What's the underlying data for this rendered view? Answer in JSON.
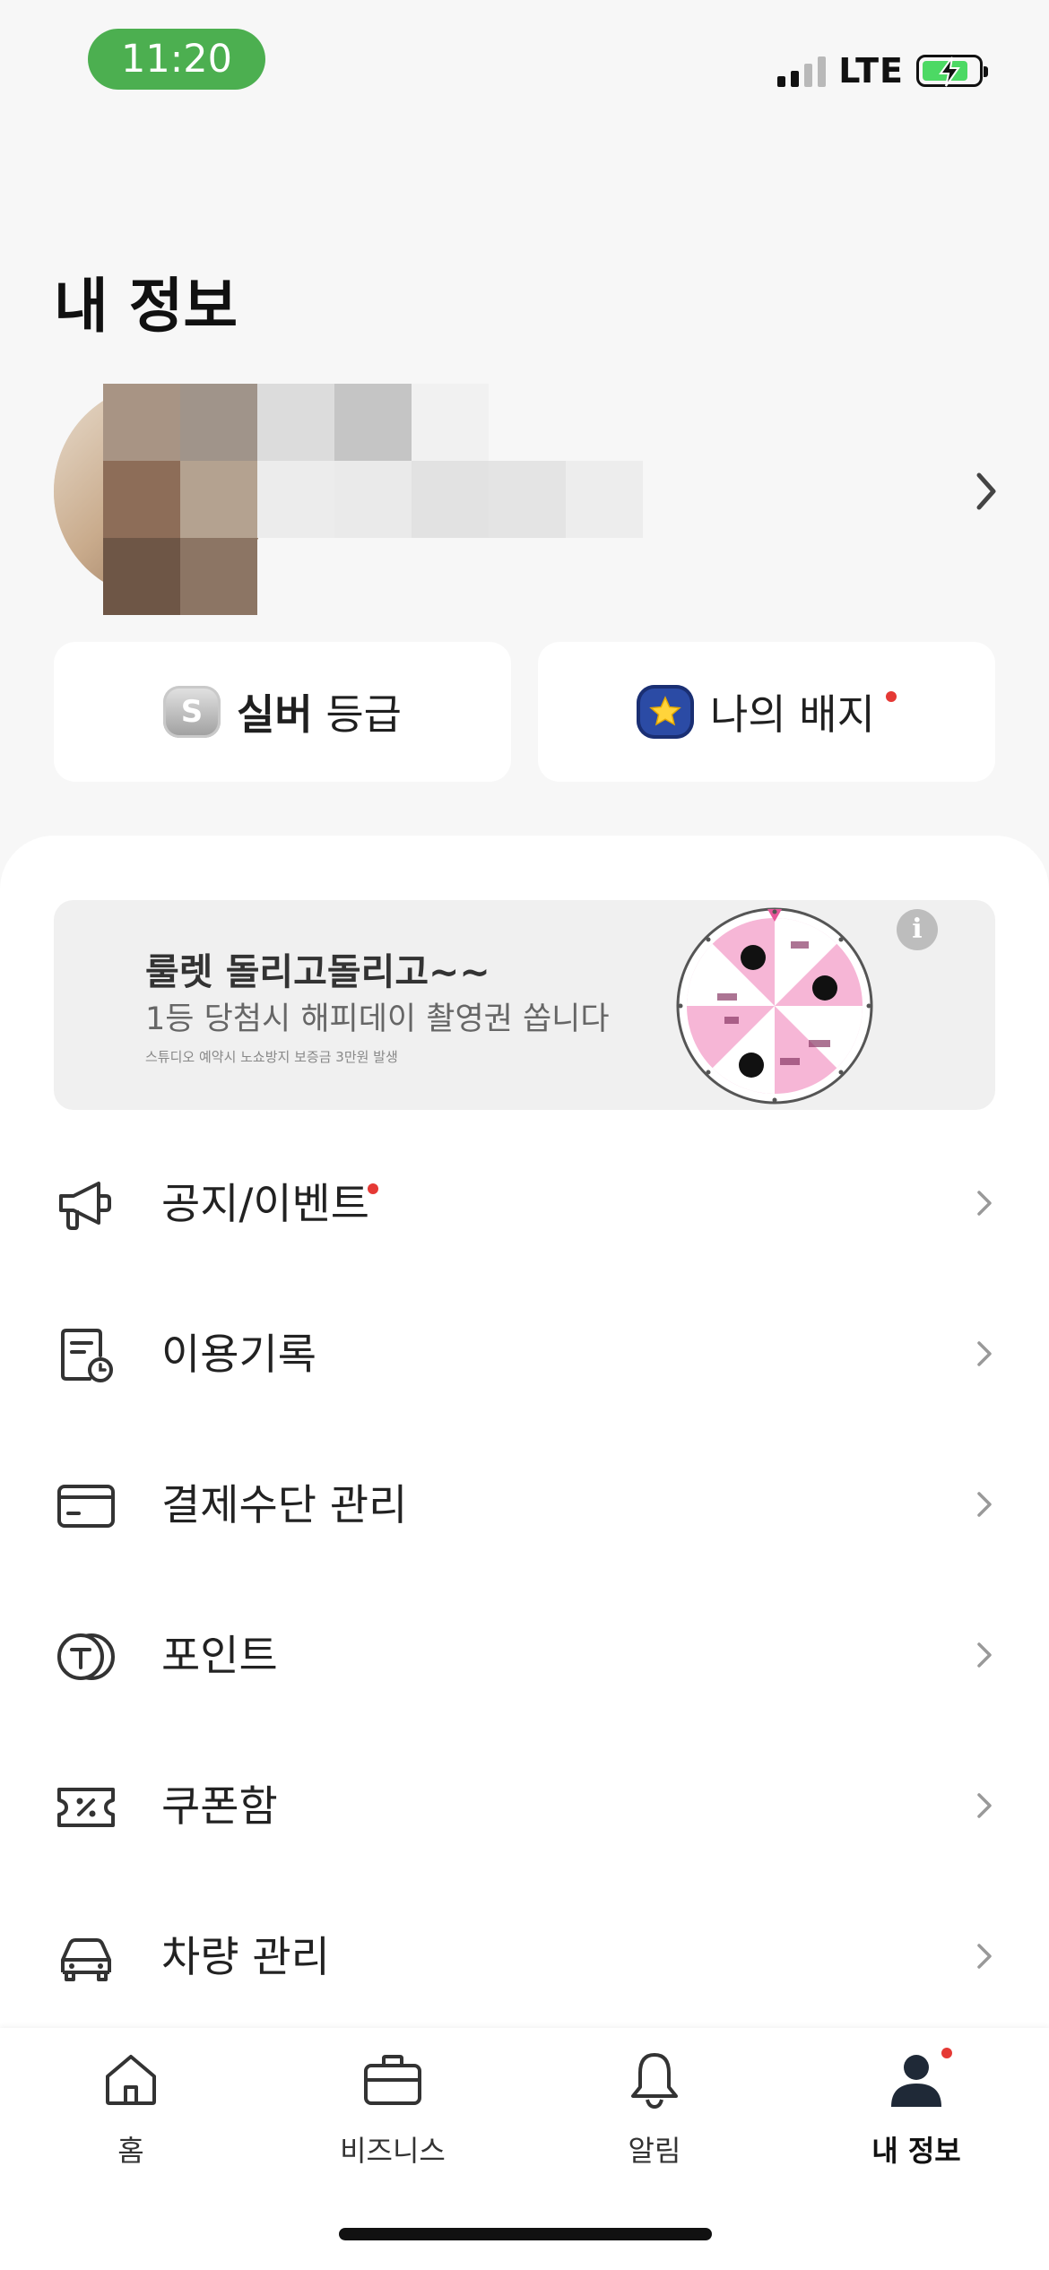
{
  "status": {
    "time": "11:20",
    "network": "LTE"
  },
  "page": {
    "title": "내 정보"
  },
  "grade": {
    "name": "실버",
    "suffix": "등급",
    "coin_letter": "S"
  },
  "badge": {
    "label": "나의 배지"
  },
  "banner": {
    "title": "룰렛 돌리고돌리고~~",
    "subtitle": "1등 당첨시 해피데이 촬영권 쏩니다",
    "note": "스튜디오 예약시 노쇼방지 보증금 3만원 발생"
  },
  "menu": [
    {
      "label": "공지/이벤트",
      "icon": "megaphone-icon"
    },
    {
      "label": "이용기록",
      "icon": "receipt-clock-icon"
    },
    {
      "label": "결제수단 관리",
      "icon": "card-icon"
    },
    {
      "label": "포인트",
      "icon": "point-coin-icon"
    },
    {
      "label": "쿠폰함",
      "icon": "coupon-icon"
    },
    {
      "label": "차량 관리",
      "icon": "car-icon"
    }
  ],
  "tabs": [
    {
      "label": "홈",
      "icon": "home-icon"
    },
    {
      "label": "비즈니스",
      "icon": "briefcase-icon"
    },
    {
      "label": "알림",
      "icon": "bell-icon"
    },
    {
      "label": "내 정보",
      "icon": "person-icon"
    }
  ],
  "colors": {
    "accent_dot": "#e53935",
    "status_pill": "#4caf50",
    "battery": "#4cd964"
  }
}
